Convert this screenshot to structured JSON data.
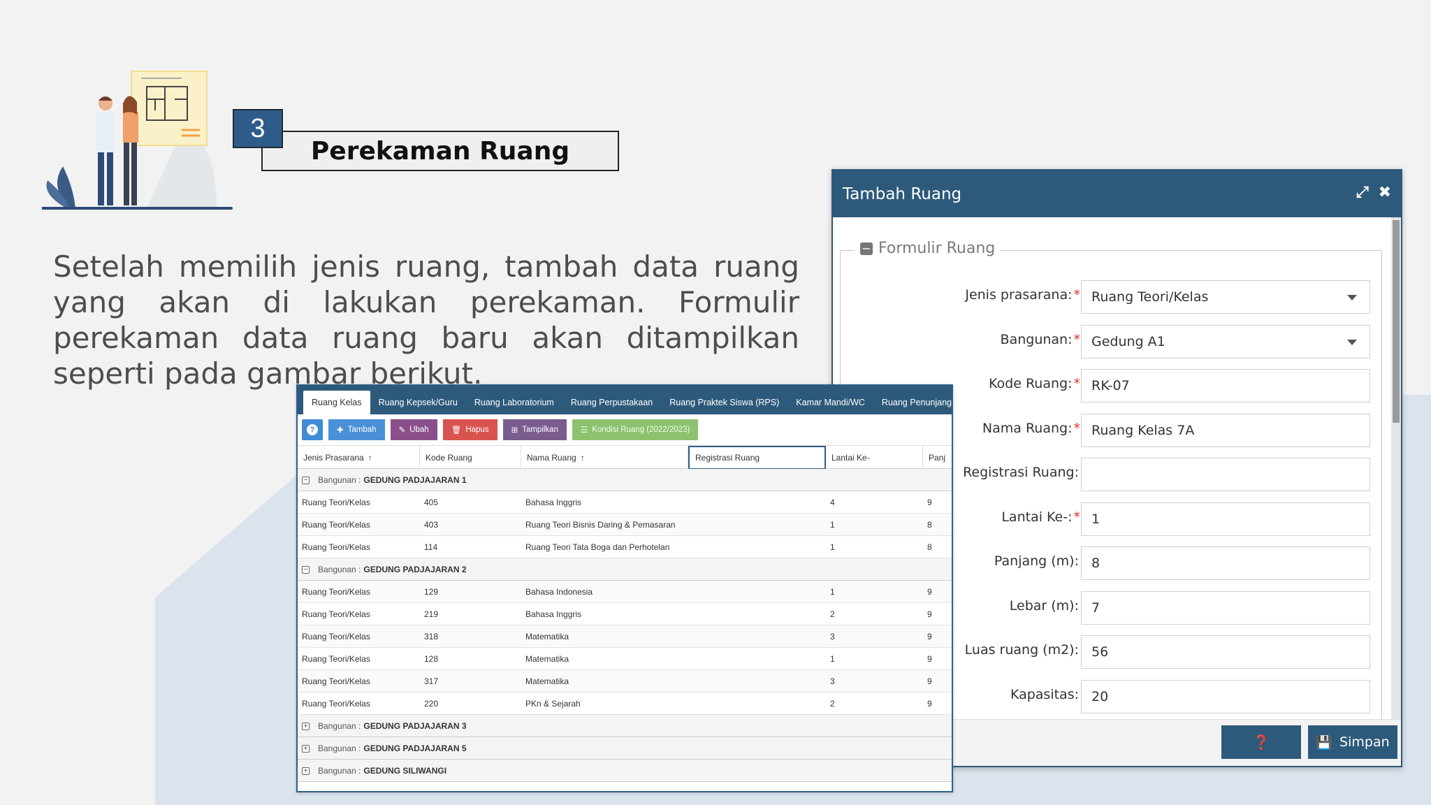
{
  "slide": {
    "step_number": "3",
    "title": "Perekaman Ruang",
    "description": "Setelah memilih jenis ruang, tambah data ruang yang akan di lakukan perekaman. Formulir perekaman data ruang baru akan ditampilkan seperti pada gambar berikut."
  },
  "modal": {
    "title": "Tambah Ruang",
    "icons": [
      "expand-icon",
      "close-icon"
    ],
    "fieldset_legend": "Formulir Ruang",
    "fields": [
      {
        "label": "Jenis prasarana:",
        "required": "*",
        "value": "Ruang Teori/Kelas",
        "type": "select"
      },
      {
        "label": "Bangunan:",
        "required": "*",
        "value": "Gedung A1",
        "type": "select"
      },
      {
        "label": "Kode Ruang:",
        "required": "*",
        "value": "RK-07",
        "type": "text"
      },
      {
        "label": "Nama Ruang:",
        "required": "*",
        "value": "Ruang Kelas 7A",
        "type": "text"
      },
      {
        "label": "Registrasi Ruang:",
        "required": "",
        "value": "",
        "type": "text"
      },
      {
        "label": "Lantai Ke-:",
        "required": "*",
        "value": "1",
        "type": "text"
      },
      {
        "label": "Panjang (m):",
        "required": "",
        "value": "8",
        "type": "text"
      },
      {
        "label": "Lebar (m):",
        "required": "",
        "value": "7",
        "type": "text"
      },
      {
        "label": "Luas ruang (m2):",
        "required": "",
        "value": "56",
        "type": "text"
      },
      {
        "label": "Kapasitas:",
        "required": "",
        "value": "20",
        "type": "text"
      }
    ],
    "help_icon": "question-icon",
    "save_label": "Simpan"
  },
  "table_panel": {
    "tabs": [
      "Ruang Kelas",
      "Ruang Kepsek/Guru",
      "Ruang Laboratorium",
      "Ruang Perpustakaan",
      "Ruang Praktek Siswa (RPS)",
      "Kamar Mandi/WC",
      "Ruang Penunjang"
    ],
    "active_tab": 0,
    "toolbar": {
      "tambah": "Tambah",
      "ubah": "Ubah",
      "hapus": "Hapus",
      "tampilkan": "Tampilkan",
      "kondisi": "Kondisi Ruang (2022/2023)"
    },
    "columns": [
      "Jenis Prasarana",
      "Kode Ruang",
      "Nama Ruang",
      "Registrasi Ruang",
      "Lantai Ke-",
      "Panj"
    ],
    "group_prefix": "Bangunan :",
    "groups": [
      {
        "name": "GEDUNG PADJAJARAN 1",
        "expanded": true,
        "rows": [
          [
            "Ruang Teori/Kelas",
            "405",
            "Bahasa Inggris",
            "",
            "4",
            "9"
          ],
          [
            "Ruang Teori/Kelas",
            "403",
            "Ruang Teori Bisnis Daring & Pemasaran",
            "",
            "1",
            "8"
          ],
          [
            "Ruang Teori/Kelas",
            "114",
            "Ruang Teori Tata Boga dan Perhotelan",
            "",
            "1",
            "8"
          ]
        ]
      },
      {
        "name": "GEDUNG PADJAJARAN 2",
        "expanded": true,
        "rows": [
          [
            "Ruang Teori/Kelas",
            "129",
            "Bahasa Indonesia",
            "",
            "1",
            "9"
          ],
          [
            "Ruang Teori/Kelas",
            "219",
            "Bahasa Inggris",
            "",
            "2",
            "9"
          ],
          [
            "Ruang Teori/Kelas",
            "318",
            "Matematika",
            "",
            "3",
            "9"
          ],
          [
            "Ruang Teori/Kelas",
            "128",
            "Matematika",
            "",
            "1",
            "9"
          ],
          [
            "Ruang Teori/Kelas",
            "317",
            "Matematika",
            "",
            "3",
            "9"
          ],
          [
            "Ruang Teori/Kelas",
            "220",
            "PKn & Sejarah",
            "",
            "2",
            "9"
          ]
        ]
      },
      {
        "name": "GEDUNG PADJAJARAN 3",
        "expanded": false,
        "rows": []
      },
      {
        "name": "GEDUNG PADJAJARAN 5",
        "expanded": false,
        "rows": []
      },
      {
        "name": "GEDUNG SILIWANGI",
        "expanded": false,
        "rows": []
      }
    ]
  },
  "colors": {
    "accent": "#2d5a7b",
    "required": "#d9342b",
    "background": "#f2f2f2",
    "bg_shape": "#dbe3ec"
  }
}
